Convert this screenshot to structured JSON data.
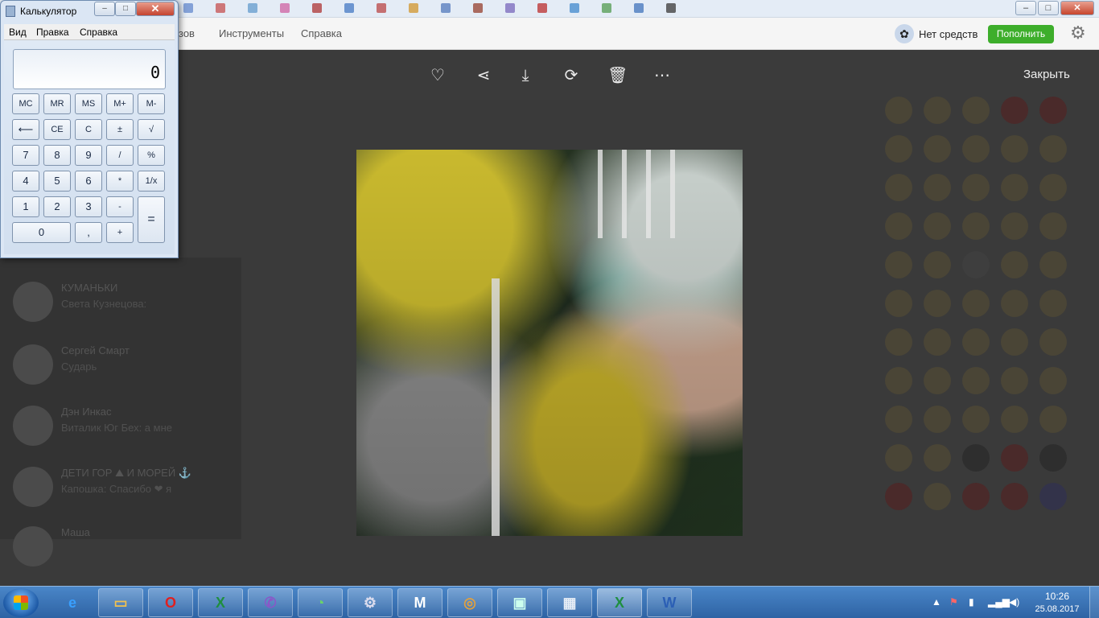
{
  "calculator": {
    "title": "Калькулятор",
    "close_label": "✕",
    "menu": [
      "Вид",
      "Правка",
      "Справка"
    ],
    "display": "0",
    "keys": {
      "mc": "MC",
      "mr": "MR",
      "ms": "MS",
      "mplus": "M+",
      "mminus": "M-",
      "backspace": "⟵",
      "ce": "CE",
      "c": "C",
      "plusminus": "±",
      "sqrt": "√",
      "n7": "7",
      "n8": "8",
      "n9": "9",
      "div": "/",
      "pct": "%",
      "n4": "4",
      "n5": "5",
      "n6": "6",
      "mul": "*",
      "inv": "1/x",
      "n1": "1",
      "n2": "2",
      "n3": "3",
      "minus": "-",
      "eq": "=",
      "n0": "0",
      "comma": ",",
      "plus": "+"
    }
  },
  "app": {
    "menu": {
      "partial": "зов",
      "tools": "Инструменты",
      "help": "Справка"
    },
    "balance_text": "Нет средств",
    "topup_label": "Пополнить",
    "chats": [
      {
        "name": "КУМАНЬКИ",
        "msg": "Света Кузнецова:"
      },
      {
        "name": "Сергей Смарт",
        "msg": "Сударь"
      },
      {
        "name": "Дэн  Инкас",
        "msg": "Виталик Юг Бех: а мне"
      },
      {
        "name": "ДЕТИ ГОР ⛰ И МОРЕЙ ⚓",
        "msg": "Капошка: Спасибо ❤ я"
      },
      {
        "name": "Маша",
        "msg": ""
      }
    ]
  },
  "viewer": {
    "close_label": "Закрыть",
    "tools": [
      "heart-icon",
      "share-icon",
      "download-icon",
      "rotate-icon",
      "trash-icon",
      "more-icon"
    ]
  },
  "taskbar": {
    "apps": [
      "ie",
      "explorer",
      "opera",
      "excel",
      "viber",
      "app-green",
      "gear",
      "maxthon",
      "app-disk",
      "monitor",
      "calculator",
      "excel-active",
      "word"
    ],
    "clock_time": "10:26",
    "clock_date": "25.08.2017"
  }
}
